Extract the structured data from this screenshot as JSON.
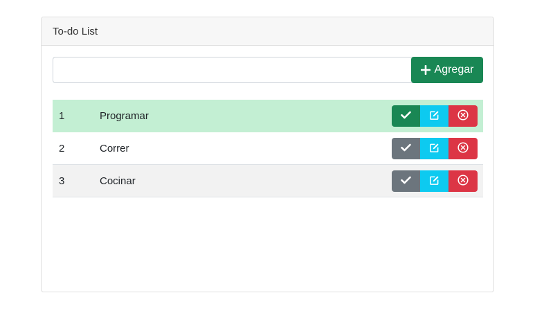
{
  "card": {
    "title": "To-do List"
  },
  "add_form": {
    "input_value": "",
    "button_label": "Agregar"
  },
  "tasks": [
    {
      "number": "1",
      "name": "Programar",
      "completed": true
    },
    {
      "number": "2",
      "name": "Correr",
      "completed": false
    },
    {
      "number": "3",
      "name": "Cocinar",
      "completed": false
    }
  ],
  "colors": {
    "success": "#198754",
    "secondary": "#6c757d",
    "info": "#0dcaf0",
    "danger": "#dc3545",
    "completed_row": "#c3efd3"
  },
  "icons": {
    "add": "plus-icon",
    "complete": "check-icon",
    "edit": "edit-icon",
    "delete": "x-circle-icon"
  }
}
